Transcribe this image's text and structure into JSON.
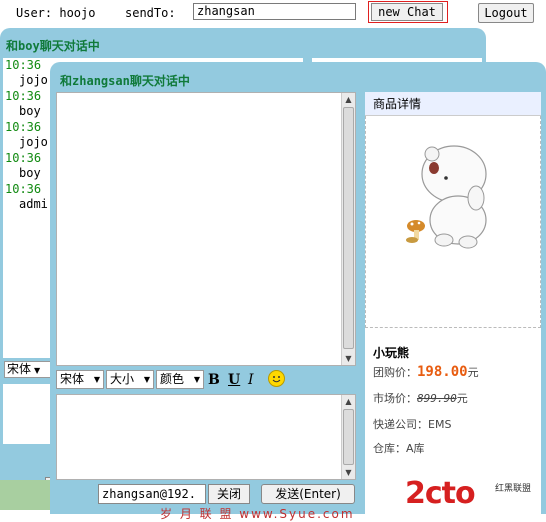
{
  "topbar": {
    "user_label": "User: hoojo",
    "sendto_label": "sendTo:",
    "sendto_value": "zhangsan",
    "new_chat_label": "new Chat",
    "logout_label": "Logout"
  },
  "back_window": {
    "title_prefix": "和",
    "title_user": "boy",
    "title_suffix": "聊天对话中",
    "messages": [
      {
        "time": "10:36",
        "text": "jojo"
      },
      {
        "time": "10:36",
        "text": "boy"
      },
      {
        "time": "10:36",
        "text": "jojo"
      },
      {
        "time": "10:36",
        "text": "boy"
      },
      {
        "time": "10:36",
        "text": "admi"
      }
    ],
    "font_select": "宋体"
  },
  "front_window": {
    "title_prefix": "和",
    "title_user": "zhangsan",
    "title_suffix": "聊天对话中",
    "toolbar": {
      "font": "宋体",
      "size": "大小",
      "color": "颜色",
      "bold": "B",
      "underline": "U",
      "italic": "I"
    },
    "sender_value": "zhangsan@192.",
    "close_label": "关闭",
    "send_label": "发送(Enter)"
  },
  "product": {
    "header": "商品详情",
    "name": "小玩熊",
    "group_price_label": "团购价：",
    "group_price": "198.00",
    "currency": "元",
    "market_price_label": "市场价：",
    "market_price": "899.90",
    "shipping_label": "快递公司：",
    "shipping": "EMS",
    "warehouse_label": "仓库：",
    "warehouse": "A库"
  },
  "watermark": {
    "logo": "2cto",
    "small": "红黑联盟",
    "footer": "岁 月 联 盟  www.Syue.com"
  },
  "colors": {
    "window_bg": "#93cadf",
    "title_green": "#107a3a",
    "time_green": "#118a11",
    "price_orange": "#e85c10",
    "new_chat_outline": "#e02020"
  }
}
